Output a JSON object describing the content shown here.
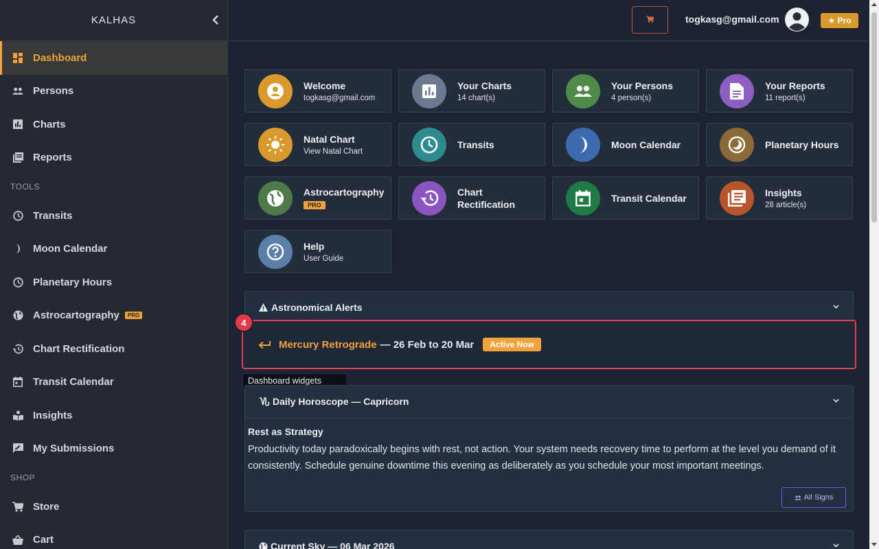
{
  "sidebar": {
    "brand": "KALHAS",
    "collapse_icon": "chevron-left-icon",
    "items": [
      {
        "label": "Dashboard",
        "icon": "dashboard-icon",
        "active": true
      },
      {
        "label": "Persons",
        "icon": "people-icon"
      },
      {
        "label": "Charts",
        "icon": "bar-chart-icon"
      },
      {
        "label": "Reports",
        "icon": "reports-icon"
      }
    ],
    "tools_heading": "TOOLS",
    "tools": [
      {
        "label": "Transits",
        "icon": "clock-icon"
      },
      {
        "label": "Moon Calendar",
        "icon": "moon-icon"
      },
      {
        "label": "Planetary Hours",
        "icon": "clock-icon"
      },
      {
        "label": "Astrocartography",
        "icon": "globe-icon",
        "badge": "PRO"
      },
      {
        "label": "Chart Rectification",
        "icon": "history-icon"
      },
      {
        "label": "Transit Calendar",
        "icon": "calendar-icon"
      },
      {
        "label": "Insights",
        "icon": "reader-icon"
      },
      {
        "label": "My Submissions",
        "icon": "feedback-icon"
      }
    ],
    "shop_heading": "SHOP",
    "shop": [
      {
        "label": "Store",
        "icon": "cart-icon"
      },
      {
        "label": "Cart",
        "icon": "basket-icon"
      }
    ]
  },
  "header": {
    "email": "togkasg@gmail.com",
    "pro_label": "★ Pro",
    "cart_icon": "cart-icon",
    "avatar_icon": "account-circle-icon"
  },
  "cards": [
    {
      "title": "Welcome",
      "sub": "togkasg@gmail.com",
      "color": "#d99a2b",
      "icon": "account-icon"
    },
    {
      "title": "Your Charts",
      "sub": "14 chart(s)",
      "color": "#6b7a8f",
      "icon": "bar-chart-icon"
    },
    {
      "title": "Your Persons",
      "sub": "4 person(s)",
      "color": "#4f8a48",
      "icon": "people-icon"
    },
    {
      "title": "Your Reports",
      "sub": "11 report(s)",
      "color": "#8e5fc2",
      "icon": "document-icon"
    },
    {
      "title": "Natal Chart",
      "sub": "View Natal Chart",
      "color": "#d99a2b",
      "icon": "sun-icon"
    },
    {
      "title": "Transits",
      "sub": "",
      "color": "#2e8c8f",
      "icon": "clock-icon"
    },
    {
      "title": "Moon Calendar",
      "sub": "",
      "color": "#3c6bb0",
      "icon": "moon-icon"
    },
    {
      "title": "Planetary Hours",
      "sub": "",
      "color": "#8a6a35",
      "icon": "planet-icon"
    },
    {
      "title": "Astrocartography",
      "sub": "",
      "badge": "PRO",
      "color": "#4e7a4a",
      "icon": "globe-icon"
    },
    {
      "title": "Chart Rectification",
      "title_line1": "Chart",
      "title_line2": "Rectification",
      "sub": "",
      "color": "#8a55c0",
      "icon": "history-icon"
    },
    {
      "title": "Transit Calendar",
      "sub": "",
      "color": "#1f7a45",
      "icon": "calendar-icon"
    },
    {
      "title": "Insights",
      "sub": "28 article(s)",
      "color": "#b8552d",
      "icon": "reader-icon"
    },
    {
      "title": "Help",
      "sub": "User Guide",
      "color": "#5b7fa8",
      "icon": "help-icon"
    }
  ],
  "alerts": {
    "title": "Astronomical Alerts",
    "icon": "warning-icon",
    "marker": "4",
    "item": {
      "icon": "arrow-left-icon",
      "name": "Mercury Retrograde",
      "dates": "— 26 Feb to 20 Mar",
      "status": "Active Now"
    }
  },
  "tooltip": "Dashboard widgets",
  "horoscope": {
    "title": "Daily Horoscope — Capricorn",
    "icon": "capricorn-icon",
    "heading": "Rest as Strategy",
    "text": "Productivity today paradoxically begins with rest, not action. Your system needs recovery time to perform at the level you demand of it consistently. Schedule genuine downtime this evening as deliberately as you schedule your most important meetings.",
    "button": "All Signs"
  },
  "current_sky": {
    "title": "Current Sky — 06 Mar 2026",
    "icon": "globe-icon"
  }
}
